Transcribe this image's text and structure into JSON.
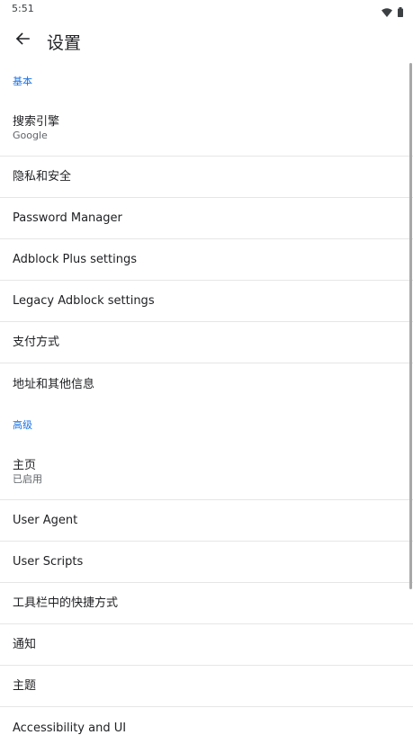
{
  "status_bar": {
    "time": "5:51",
    "icons": [
      "wifi-icon",
      "battery-icon"
    ]
  },
  "app_bar": {
    "title": "设置",
    "back_icon": "arrow-left-icon"
  },
  "sections": {
    "basic": {
      "header": "基本",
      "items": {
        "search_engine": {
          "title": "搜索引擎",
          "subtitle": "Google"
        },
        "privacy": {
          "title": "隐私和安全"
        },
        "password_manager": {
          "title": "Password Manager"
        },
        "adblock_plus": {
          "title": "Adblock Plus settings"
        },
        "legacy_adblock": {
          "title": "Legacy Adblock settings"
        },
        "payment": {
          "title": "支付方式"
        },
        "addresses": {
          "title": "地址和其他信息"
        }
      }
    },
    "advanced": {
      "header": "高级",
      "items": {
        "homepage": {
          "title": "主页",
          "subtitle": "已启用"
        },
        "user_agent": {
          "title": "User Agent"
        },
        "user_scripts": {
          "title": "User Scripts"
        },
        "toolbar_shortcut": {
          "title": "工具栏中的快捷方式"
        },
        "notifications": {
          "title": "通知"
        },
        "theme": {
          "title": "主题"
        },
        "accessibility": {
          "title": "Accessibility and UI"
        }
      }
    }
  },
  "colors": {
    "accent": "#1a73e8",
    "text_primary": "#202124",
    "text_secondary": "#5f6368",
    "divider": "#e6e6e6"
  }
}
